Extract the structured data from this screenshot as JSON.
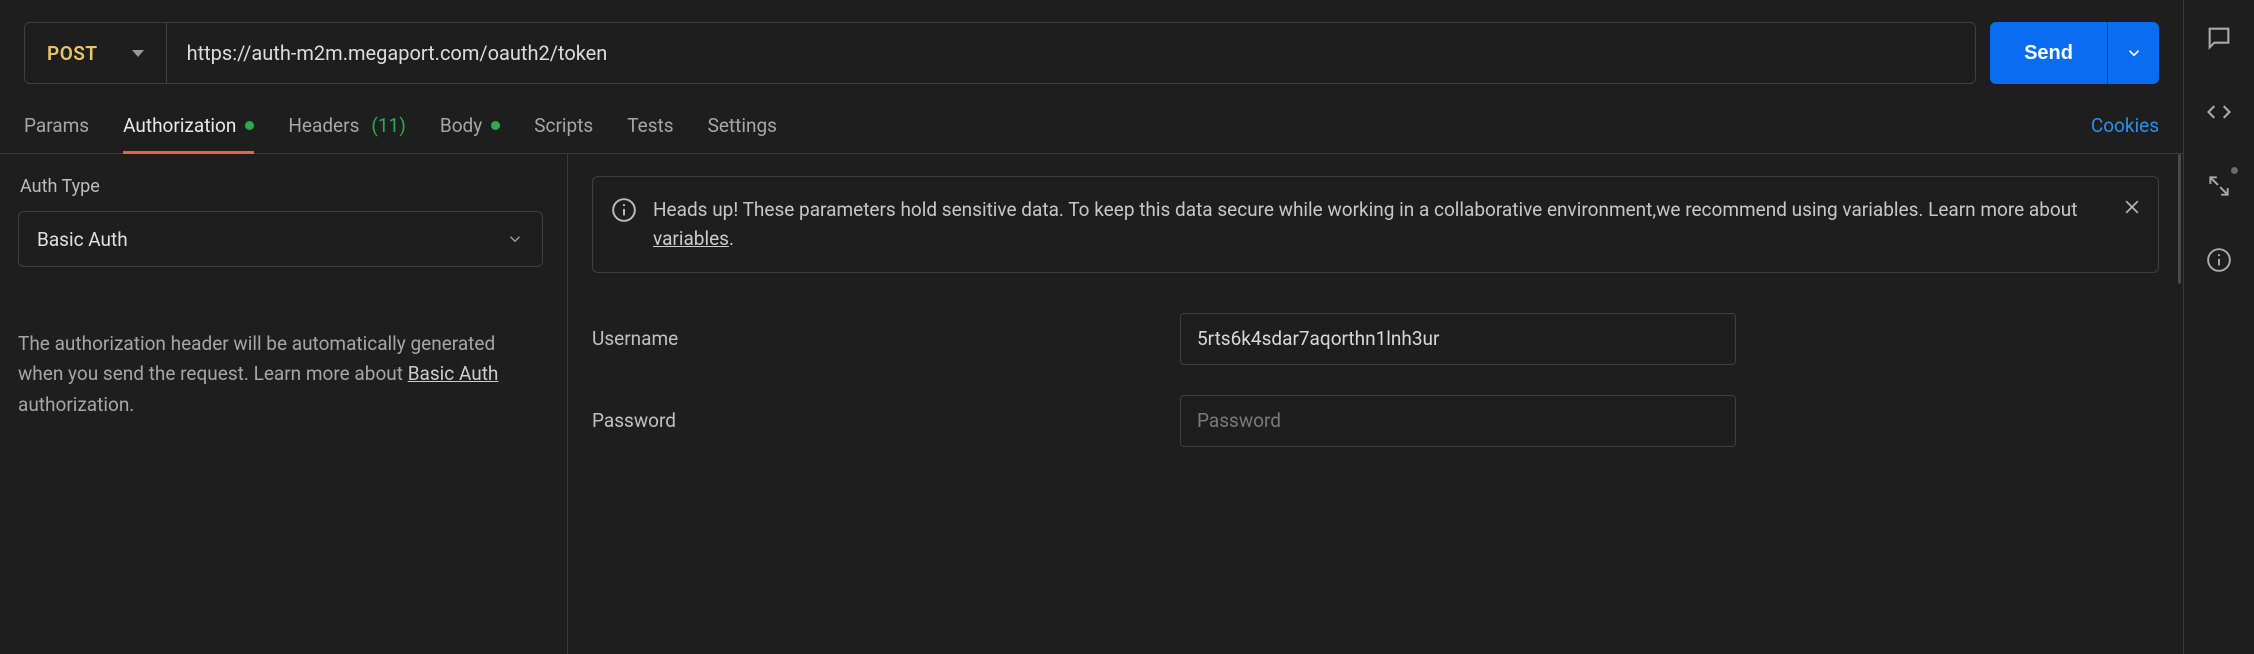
{
  "request": {
    "method": "POST",
    "url": "https://auth-m2m.megaport.com/oauth2/token",
    "send_label": "Send"
  },
  "tabs": {
    "params": "Params",
    "authorization": "Authorization",
    "headers_label": "Headers",
    "headers_count": "(11)",
    "body": "Body",
    "scripts": "Scripts",
    "tests": "Tests",
    "settings": "Settings",
    "cookies": "Cookies"
  },
  "auth_panel": {
    "type_label": "Auth Type",
    "type_value": "Basic Auth",
    "help_pre": "The authorization header will be automatically generated when you send the request. Learn more about ",
    "help_link": "Basic Auth",
    "help_post": " authorization."
  },
  "banner": {
    "text_pre": "Heads up! These parameters hold sensitive data. To keep this data secure while working in a collaborative environment,we recommend using variables. Learn more about ",
    "link": "variables",
    "text_post": "."
  },
  "form": {
    "username_label": "Username",
    "username_value": "5rts6k4sdar7aqorthn1lnh3ur",
    "password_label": "Password",
    "password_placeholder": "Password"
  }
}
